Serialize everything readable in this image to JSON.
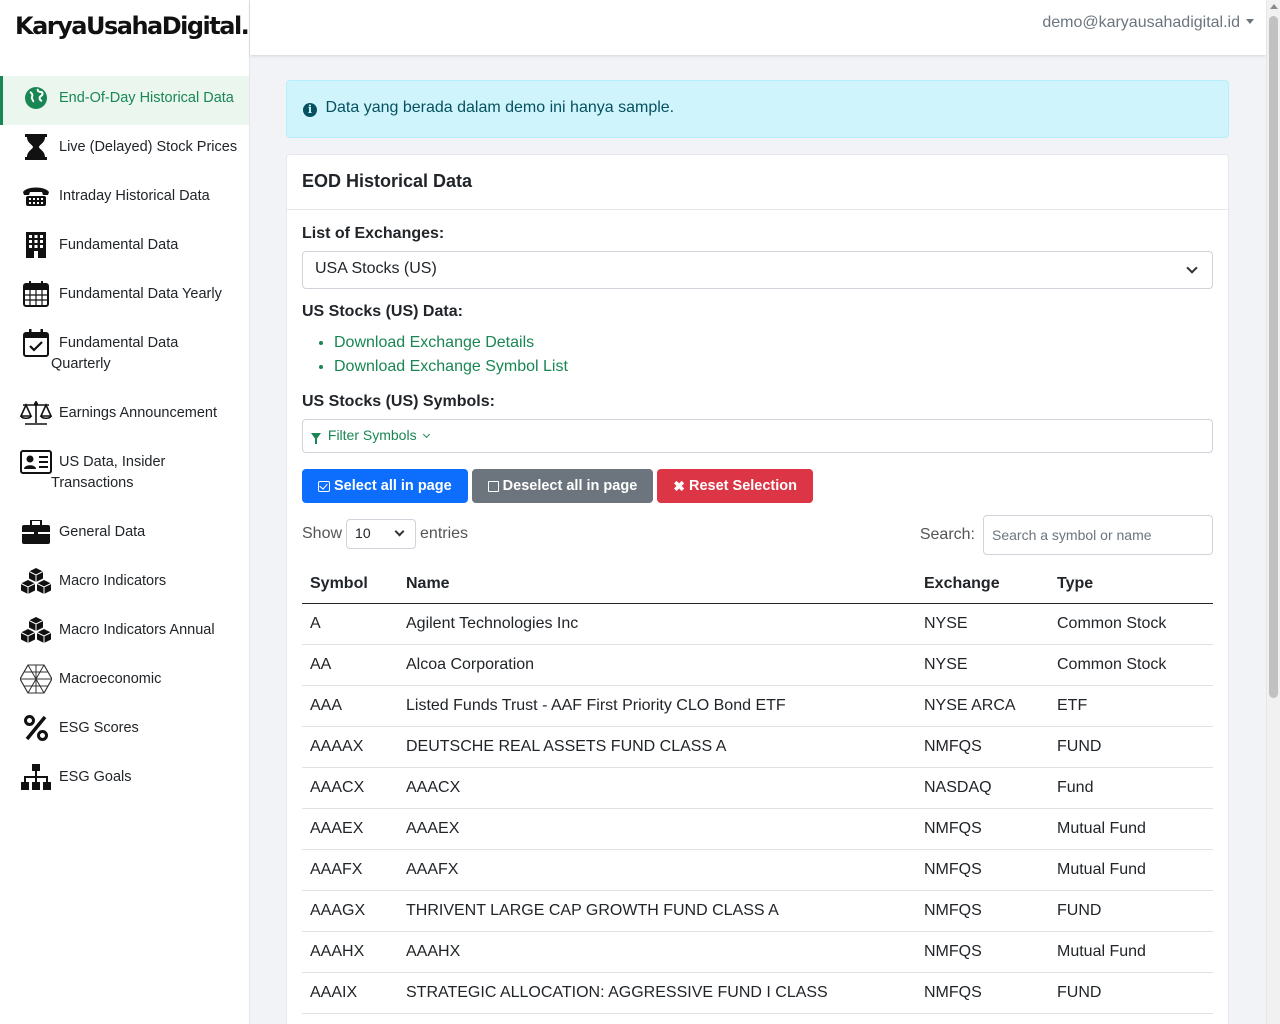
{
  "brand": "KaryaUsahaDigital.ID",
  "user_email": "demo@karyausahadigital.id",
  "sidebar": {
    "items": [
      {
        "label": "End-Of-Day Historical Data",
        "icon": "globe-icon",
        "active": true
      },
      {
        "label": "Live (Delayed) Stock Prices",
        "icon": "hourglass-icon"
      },
      {
        "label": "Intraday Historical Data",
        "icon": "telephone-icon"
      },
      {
        "label": "Fundamental Data",
        "icon": "building-icon"
      },
      {
        "label": "Fundamental Data Yearly",
        "icon": "calendar-icon"
      },
      {
        "label": "Fundamental Data",
        "label2": "Quarterly",
        "icon": "calendar-check-icon"
      },
      {
        "label": "Earnings Announcement",
        "icon": "balance-scale-icon"
      },
      {
        "label": "US Data, Insider",
        "label2": "Transactions",
        "icon": "id-card-icon"
      },
      {
        "label": "General Data",
        "icon": "briefcase-icon"
      },
      {
        "label": "Macro Indicators",
        "icon": "cubes-icon"
      },
      {
        "label": "Macro Indicators Annual",
        "icon": "cubes-icon"
      },
      {
        "label": "Macroeconomic",
        "icon": "mesh-icon"
      },
      {
        "label": "ESG Scores",
        "icon": "percent-icon"
      },
      {
        "label": "ESG Goals",
        "icon": "sitemap-icon"
      }
    ]
  },
  "alert": {
    "text": "Data yang berada dalam demo ini hanya sample."
  },
  "card": {
    "title": "EOD Historical Data",
    "exchanges_label": "List of Exchanges:",
    "exchange_selected": "USA Stocks (US)",
    "data_label": "US Stocks (US) Data:",
    "links": [
      "Download Exchange Details",
      "Download Exchange Symbol List"
    ],
    "symbols_label": "US Stocks (US) Symbols:",
    "filter_label": "Filter Symbols",
    "buttons": {
      "select_all": "Select all in page",
      "deselect_all": "Deselect all in page",
      "reset": "Reset Selection"
    },
    "show_label": "Show",
    "entries_value": "10",
    "entries_label": "entries",
    "search_label": "Search:",
    "search_placeholder": "Search a symbol or name"
  },
  "table": {
    "columns": [
      "Symbol",
      "Name",
      "Exchange",
      "Type"
    ],
    "rows": [
      [
        "A",
        "Agilent Technologies Inc",
        "NYSE",
        "Common Stock"
      ],
      [
        "AA",
        "Alcoa Corporation",
        "NYSE",
        "Common Stock"
      ],
      [
        "AAA",
        "Listed Funds Trust - AAF First Priority CLO Bond ETF",
        "NYSE ARCA",
        "ETF"
      ],
      [
        "AAAAX",
        "DEUTSCHE REAL ASSETS FUND CLASS A",
        "NMFQS",
        "FUND"
      ],
      [
        "AAACX",
        "AAACX",
        "NASDAQ",
        "Fund"
      ],
      [
        "AAAEX",
        "AAAEX",
        "NMFQS",
        "Mutual Fund"
      ],
      [
        "AAAFX",
        "AAAFX",
        "NMFQS",
        "Mutual Fund"
      ],
      [
        "AAAGX",
        "THRIVENT LARGE CAP GROWTH FUND CLASS A",
        "NMFQS",
        "FUND"
      ],
      [
        "AAAHX",
        "AAAHX",
        "NMFQS",
        "Mutual Fund"
      ],
      [
        "AAAIX",
        "STRATEGIC ALLOCATION: AGGRESSIVE FUND I CLASS",
        "NMFQS",
        "FUND"
      ]
    ]
  },
  "colors": {
    "accent": "#198754",
    "primary": "#0d6efd",
    "secondary": "#6c757d",
    "danger": "#dc3545",
    "info_bg": "#cff4fc"
  }
}
